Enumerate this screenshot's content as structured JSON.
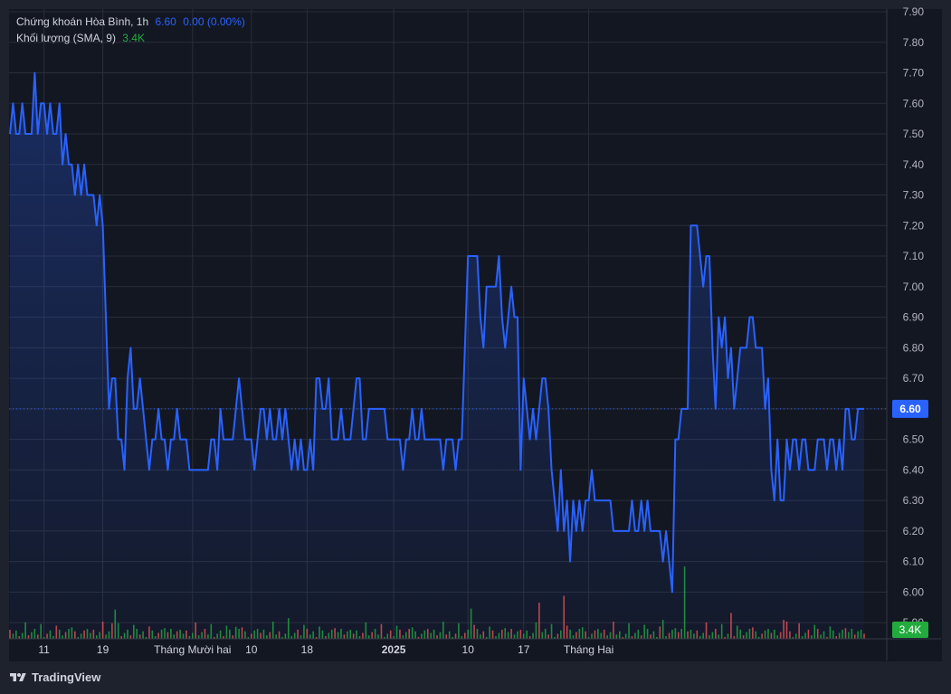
{
  "legend": {
    "symbol": "Chứng khoán Hòa Bình, 1h",
    "price": "6.60",
    "change": "0.00 (0.00%)",
    "volume_label": "Khối lượng (SMA, 9)",
    "volume_value": "3.4K"
  },
  "price_tag": "6.60",
  "volume_tag": "3.4K",
  "footer_brand": "TradingView",
  "colors": {
    "line": "#2962ff",
    "background": "#131722",
    "grid": "#2a2e39",
    "volume_up": "#26a69a",
    "volume_up_bright": "#22ab3c",
    "volume_down": "#ef5350",
    "price_tag_bg": "#2962ff",
    "volume_tag_bg": "#22ab3c"
  },
  "chart_data": {
    "type": "area",
    "title": "Chứng khoán Hòa Bình, 1h",
    "grid": true,
    "y_axis_side": "right",
    "ylim": [
      5.85,
      7.9
    ],
    "y_ticks": [
      "7.90",
      "7.80",
      "7.70",
      "7.60",
      "7.50",
      "7.40",
      "7.30",
      "7.20",
      "7.10",
      "7.00",
      "6.90",
      "6.80",
      "6.70",
      "6.60",
      "6.50",
      "6.40",
      "6.30",
      "6.20",
      "6.10",
      "6.00",
      "5.90"
    ],
    "x_ticks": [
      "11",
      "19",
      "Tháng Mười hai",
      "10",
      "18",
      "2025",
      "10",
      "17",
      "Tháng Hai"
    ],
    "x_tick_index": [
      11,
      30,
      59,
      78,
      96,
      124,
      148,
      166,
      187
    ],
    "bold_x_ticks": [
      "2025"
    ],
    "last_price": 6.6,
    "series": [
      {
        "name": "Chứng khoán Hòa Bình",
        "values": [
          7.5,
          7.6,
          7.5,
          7.5,
          7.6,
          7.5,
          7.5,
          7.5,
          7.7,
          7.5,
          7.6,
          7.6,
          7.5,
          7.6,
          7.5,
          7.5,
          7.6,
          7.4,
          7.5,
          7.4,
          7.4,
          7.3,
          7.4,
          7.3,
          7.4,
          7.3,
          7.3,
          7.3,
          7.2,
          7.3,
          7.2,
          6.9,
          6.6,
          6.7,
          6.7,
          6.5,
          6.5,
          6.4,
          6.7,
          6.8,
          6.6,
          6.6,
          6.7,
          6.6,
          6.5,
          6.4,
          6.5,
          6.5,
          6.6,
          6.5,
          6.5,
          6.4,
          6.5,
          6.5,
          6.6,
          6.5,
          6.5,
          6.5,
          6.4,
          6.4,
          6.4,
          6.4,
          6.4,
          6.4,
          6.4,
          6.5,
          6.5,
          6.4,
          6.6,
          6.5,
          6.5,
          6.5,
          6.5,
          6.6,
          6.7,
          6.6,
          6.5,
          6.5,
          6.5,
          6.4,
          6.5,
          6.6,
          6.6,
          6.5,
          6.6,
          6.5,
          6.5,
          6.6,
          6.5,
          6.6,
          6.5,
          6.4,
          6.5,
          6.4,
          6.5,
          6.4,
          6.4,
          6.5,
          6.4,
          6.7,
          6.7,
          6.6,
          6.6,
          6.7,
          6.5,
          6.5,
          6.5,
          6.6,
          6.5,
          6.5,
          6.5,
          6.6,
          6.7,
          6.7,
          6.5,
          6.5,
          6.6,
          6.6,
          6.6,
          6.6,
          6.6,
          6.6,
          6.5,
          6.5,
          6.5,
          6.5,
          6.5,
          6.4,
          6.5,
          6.5,
          6.6,
          6.5,
          6.5,
          6.6,
          6.5,
          6.5,
          6.5,
          6.5,
          6.5,
          6.5,
          6.4,
          6.5,
          6.5,
          6.5,
          6.4,
          6.5,
          6.5,
          6.8,
          7.1,
          7.1,
          7.1,
          7.1,
          6.9,
          6.8,
          7.0,
          7.0,
          7.0,
          7.0,
          7.1,
          6.9,
          6.8,
          6.9,
          7.0,
          6.9,
          6.9,
          6.4,
          6.7,
          6.6,
          6.5,
          6.6,
          6.5,
          6.6,
          6.7,
          6.7,
          6.6,
          6.4,
          6.3,
          6.2,
          6.4,
          6.2,
          6.3,
          6.1,
          6.3,
          6.2,
          6.3,
          6.2,
          6.3,
          6.3,
          6.4,
          6.3,
          6.3,
          6.3,
          6.3,
          6.3,
          6.3,
          6.2,
          6.2,
          6.2,
          6.2,
          6.2,
          6.2,
          6.3,
          6.2,
          6.2,
          6.3,
          6.2,
          6.3,
          6.2,
          6.2,
          6.2,
          6.2,
          6.1,
          6.2,
          6.1,
          6.0,
          6.5,
          6.5,
          6.6,
          6.6,
          6.6,
          7.2,
          7.2,
          7.2,
          7.1,
          7.0,
          7.1,
          7.1,
          6.8,
          6.6,
          6.9,
          6.8,
          6.9,
          6.7,
          6.8,
          6.6,
          6.7,
          6.8,
          6.8,
          6.8,
          6.9,
          6.9,
          6.8,
          6.8,
          6.8,
          6.6,
          6.7,
          6.4,
          6.3,
          6.5,
          6.3,
          6.3,
          6.5,
          6.4,
          6.5,
          6.5,
          6.4,
          6.5,
          6.5,
          6.4,
          6.4,
          6.4,
          6.5,
          6.5,
          6.5,
          6.4,
          6.5,
          6.5,
          6.4,
          6.5,
          6.4,
          6.6,
          6.6,
          6.5,
          6.5,
          6.6,
          6.6,
          6.6
        ]
      }
    ],
    "volume_series": {
      "name": "Khối lượng (SMA, 9)",
      "notable_bars": [
        {
          "index": 34,
          "relative_height": 0.85,
          "color": "up"
        },
        {
          "index": 33,
          "relative_height": 0.45,
          "color": "down"
        },
        {
          "index": 90,
          "relative_height": 0.6,
          "color": "up"
        },
        {
          "index": 73,
          "relative_height": 0.35,
          "color": "up"
        },
        {
          "index": 149,
          "relative_height": 0.88,
          "color": "up"
        },
        {
          "index": 171,
          "relative_height": 1.05,
          "color": "down"
        },
        {
          "index": 179,
          "relative_height": 1.25,
          "color": "down"
        },
        {
          "index": 218,
          "relative_height": 2.1,
          "color": "up"
        },
        {
          "index": 233,
          "relative_height": 0.75,
          "color": "down"
        },
        {
          "index": 211,
          "relative_height": 0.55,
          "color": "up"
        },
        {
          "index": 250,
          "relative_height": 0.55,
          "color": "down"
        },
        {
          "index": 251,
          "relative_height": 0.5,
          "color": "down"
        }
      ]
    }
  }
}
